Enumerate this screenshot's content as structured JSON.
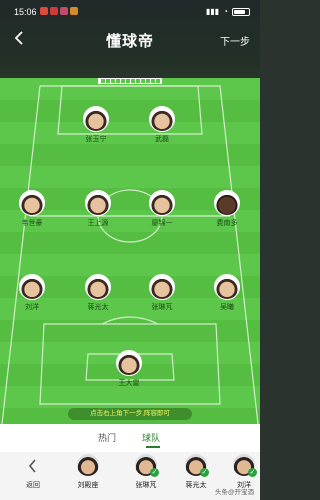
{
  "status": {
    "time": "15:06",
    "right_text": "",
    "battery_level": 0.75
  },
  "colors": {
    "pitch": "#5cc74a",
    "accent": "#2a7d2a",
    "hint_text": "#f3f35a"
  },
  "nav": {
    "title": "懂球帝",
    "next": "下一步",
    "back_icon": "chevron-left-icon"
  },
  "lineup": {
    "forwards": [
      "张玉宁",
      "武磊"
    ],
    "midfielders": [
      "韦世豪",
      "王上源",
      "廖锦一",
      "费南多"
    ],
    "defenders": [
      "刘洋",
      "蒋光太",
      "张琳芃",
      "吴曦"
    ],
    "goalkeeper": "王大雷"
  },
  "hint": "点击右上角下一步,阵容即可",
  "tabs": [
    "热门",
    "球队"
  ],
  "active_tab": 1,
  "bench": {
    "back_label": "返回",
    "players": [
      {
        "name": "刘殿座",
        "selected": false
      },
      {
        "name": "张琳芃",
        "selected": true
      },
      {
        "name": "蒋光太",
        "selected": true
      },
      {
        "name": "刘洋",
        "selected": true
      }
    ]
  },
  "watermark": "头条@开宝酒"
}
